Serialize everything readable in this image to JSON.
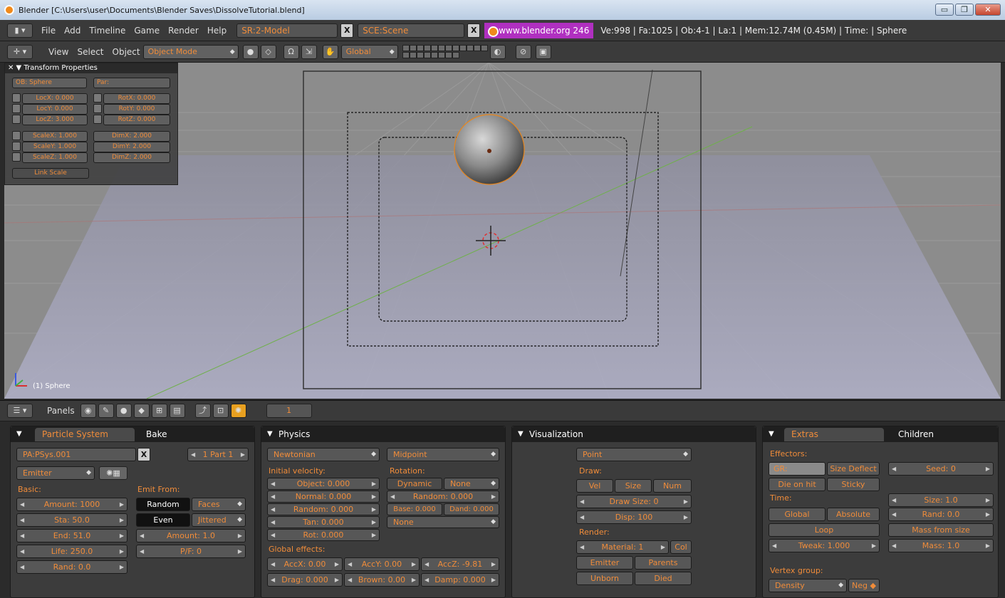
{
  "window": {
    "title": "Blender [C:\\Users\\user\\Documents\\Blender Saves\\DissolveTutorial.blend]",
    "min": "▭",
    "max": "❐",
    "close": "✕"
  },
  "infobar": {
    "menus": [
      "File",
      "Add",
      "Timeline",
      "Game",
      "Render",
      "Help"
    ],
    "screen": "SR:2-Model",
    "scene": "SCE:Scene",
    "x_label": "X",
    "site": "www.blender.org 246",
    "stats": "Ve:998 | Fa:1025 | Ob:4-1 | La:1  | Mem:12.74M (0.45M)  | Time: | Sphere"
  },
  "view3d": {
    "menus": [
      "View",
      "Select",
      "Object"
    ],
    "mode": "Object Mode",
    "orientation": "Global",
    "object_label": "(1) Sphere"
  },
  "transform": {
    "title": "Transform Properties",
    "ob": "OB: Sphere",
    "par": "Par:",
    "loc": [
      "LocX: 0.000",
      "LocY: 0.000",
      "LocZ: 3.000"
    ],
    "rot": [
      "RotX: 0.000",
      "RotY: 0.000",
      "RotZ: 0.000"
    ],
    "scale": [
      "ScaleX: 1.000",
      "ScaleY: 1.000",
      "ScaleZ: 1.000"
    ],
    "dim": [
      "DimX: 2.000",
      "DimY: 2.000",
      "DimZ: 2.000"
    ],
    "link_scale": "Link Scale"
  },
  "buttons_header": {
    "panels": "Panels",
    "frame": "1"
  },
  "particle": {
    "tab_active": "Particle System",
    "tab_bake": "Bake",
    "name": "PA:PSys.001",
    "x_label": "X",
    "part": "1 Part 1",
    "type": "Emitter",
    "basic_label": "Basic:",
    "amount": "Amount: 1000",
    "sta": "Sta: 50.0",
    "end": "End: 51.0",
    "life": "Life: 250.0",
    "rand": "Rand: 0.0",
    "emit_from_label": "Emit From:",
    "random": "Random",
    "faces": "Faces",
    "even": "Even",
    "jittered": "Jittered",
    "jit_amount": "Amount: 1.0",
    "pf": "P/F: 0"
  },
  "physics": {
    "title": "Physics",
    "type": "Newtonian",
    "integrator": "Midpoint",
    "init_vel_label": "Initial velocity:",
    "object": "Object: 0.000",
    "normal": "Normal: 0.000",
    "random": "Random: 0.000",
    "tan": "Tan: 0.000",
    "rot": "Rot: 0.000",
    "rotation_label": "Rotation:",
    "dynamic": "Dynamic",
    "none1": "None",
    "rot_random": "Random: 0.000",
    "base": "Base: 0.000",
    "dand": "Dand: 0.000",
    "none2": "None",
    "global_label": "Global effects:",
    "accx": "AccX: 0.00",
    "accy": "AccY: 0.00",
    "accz": "AccZ: -9.81",
    "drag": "Drag: 0.000",
    "brown": "Brown: 0.00",
    "damp": "Damp: 0.000"
  },
  "visualization": {
    "title": "Visualization",
    "display": "Point",
    "draw_label": "Draw:",
    "vel": "Vel",
    "size": "Size",
    "num": "Num",
    "draw_size": "Draw Size: 0",
    "disp": "Disp: 100",
    "render_label": "Render:",
    "material": "Material: 1",
    "col": "Col",
    "emitter": "Emitter",
    "parents": "Parents",
    "unborn": "Unborn",
    "died": "Died"
  },
  "extras": {
    "tab_active": "Extras",
    "tab_children": "Children",
    "effectors_label": "Effectors:",
    "gr": "GR:",
    "size_deflect": "Size Deflect",
    "die_on_hit": "Die on hit",
    "sticky": "Sticky",
    "seed": "Seed: 0",
    "time_label": "Time:",
    "global": "Global",
    "absolute": "Absolute",
    "loop": "Loop",
    "tweak": "Tweak: 1.000",
    "size": "Size: 1.0",
    "rand": "Rand: 0.0",
    "mass_from_size": "Mass from size",
    "mass": "Mass: 1.0",
    "vertex_label": "Vertex group:",
    "density": "Density",
    "neg": "Neg"
  }
}
